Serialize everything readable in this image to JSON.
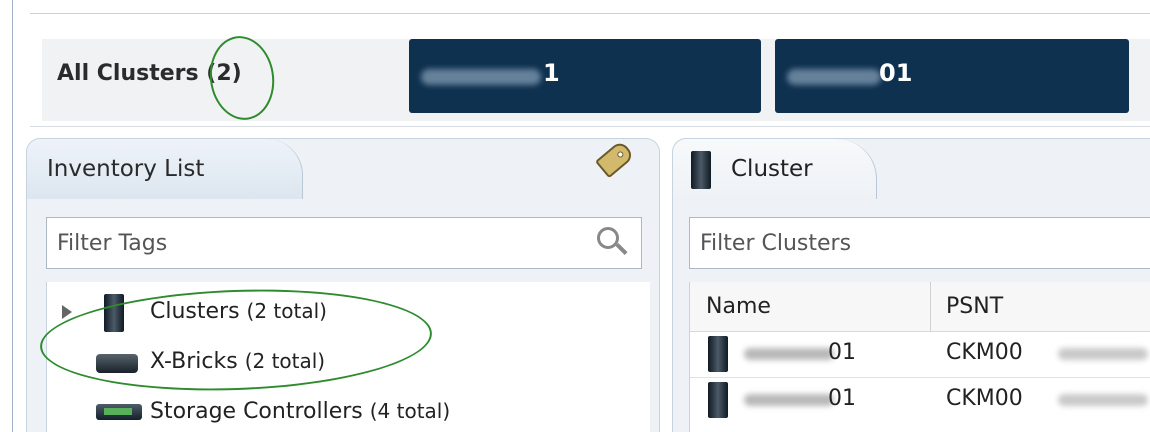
{
  "summary": {
    "all_clusters_label": "All Clusters",
    "all_clusters_count": "(2)",
    "tiles": [
      "1",
      "01"
    ]
  },
  "inventory": {
    "tab_label": "Inventory List",
    "filter_placeholder": "Filter Tags",
    "items": [
      {
        "label": "Clusters",
        "count": "(2 total)"
      },
      {
        "label": "X-Bricks",
        "count": "(2 total)"
      },
      {
        "label": "Storage Controllers",
        "count": "(4 total)"
      }
    ]
  },
  "clusters": {
    "tab_label": "Cluster",
    "filter_placeholder": "Filter Clusters",
    "columns": [
      "Name",
      "PSNT"
    ],
    "rows": [
      {
        "name": "01",
        "psnt": "CKM00"
      },
      {
        "name": "01",
        "psnt": "CKM00"
      }
    ]
  },
  "colors": {
    "tile_background": "#0f3150",
    "highlight_circle": "#2e8b2e",
    "panel_background": "#eef2f6"
  }
}
